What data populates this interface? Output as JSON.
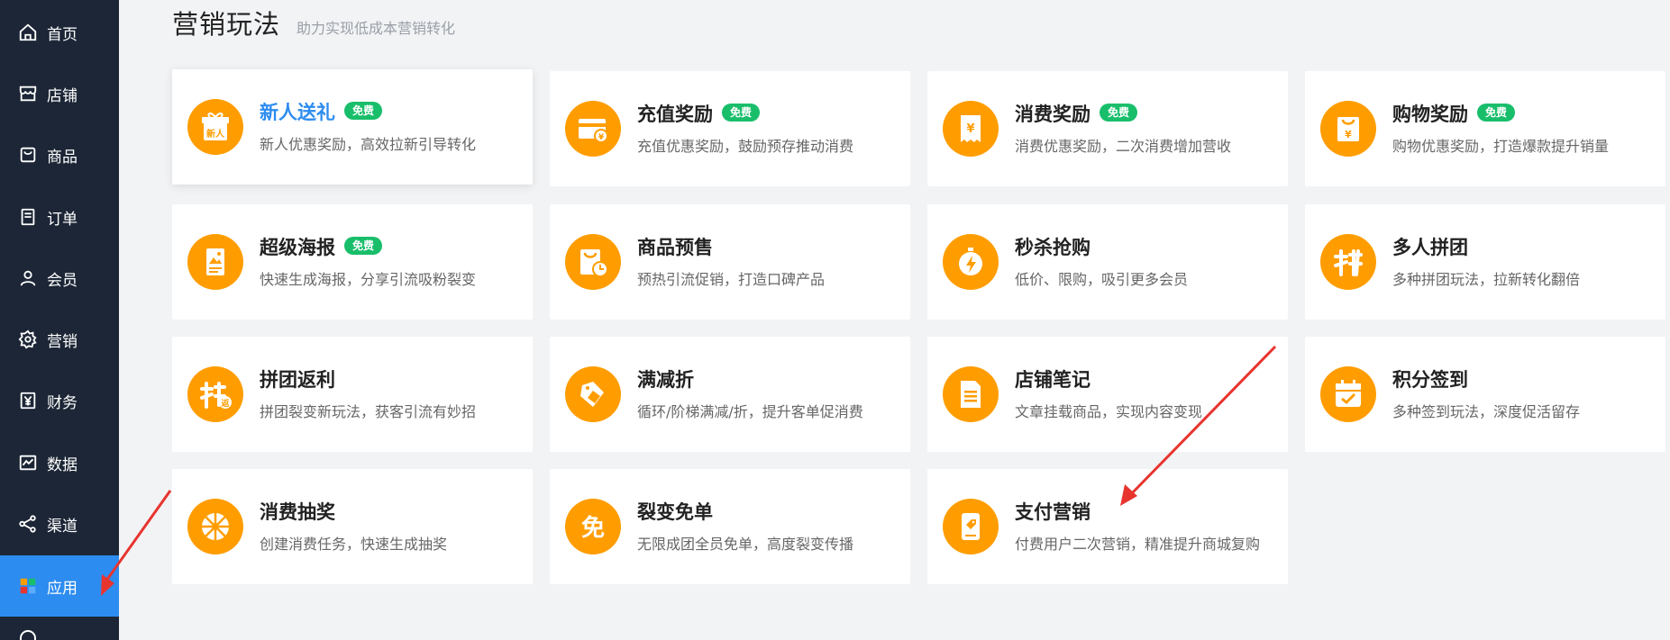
{
  "sidebar": {
    "items": [
      {
        "label": "首页",
        "icon": "home-icon"
      },
      {
        "label": "店铺",
        "icon": "store-icon"
      },
      {
        "label": "商品",
        "icon": "bag-icon"
      },
      {
        "label": "订单",
        "icon": "order-icon"
      },
      {
        "label": "会员",
        "icon": "user-icon"
      },
      {
        "label": "营销",
        "icon": "gear-icon"
      },
      {
        "label": "财务",
        "icon": "yen-icon"
      },
      {
        "label": "数据",
        "icon": "chart-icon"
      },
      {
        "label": "渠道",
        "icon": "share-icon"
      },
      {
        "label": "应用",
        "icon": "apps-icon",
        "active": true
      }
    ]
  },
  "header": {
    "title": "营销玩法",
    "subtitle": "助力实现低成本营销转化"
  },
  "cards": [
    {
      "title": "新人送礼",
      "desc": "新人优惠奖励，高效拉新引导转化",
      "badge": "免费",
      "icon": "gift-new-icon"
    },
    {
      "title": "充值奖励",
      "desc": "充值优惠奖励，鼓励预存推动消费",
      "badge": "免费",
      "icon": "recharge-card-icon"
    },
    {
      "title": "消费奖励",
      "desc": "消费优惠奖励，二次消费增加营收",
      "badge": "免费",
      "icon": "receipt-yen-icon"
    },
    {
      "title": "购物奖励",
      "desc": "购物优惠奖励，打造爆款提升销量",
      "badge": "免费",
      "icon": "shopping-bag-yen-icon"
    },
    {
      "title": "超级海报",
      "desc": "快速生成海报，分享引流吸粉裂变",
      "badge": "免费",
      "icon": "poster-icon"
    },
    {
      "title": "商品预售",
      "desc": "预热引流促销，打造口碑产品",
      "badge": "",
      "icon": "presale-clock-icon"
    },
    {
      "title": "秒杀抢购",
      "desc": "低价、限购，吸引更多会员",
      "badge": "",
      "icon": "flash-sale-icon"
    },
    {
      "title": "多人拼团",
      "desc": "多种拼团玩法，拉新转化翻倍",
      "badge": "",
      "icon": "group-buy-icon"
    },
    {
      "title": "拼团返利",
      "desc": "拼团裂变新玩法，获客引流有妙招",
      "badge": "",
      "icon": "group-rebate-icon"
    },
    {
      "title": "满减折",
      "desc": "循环/阶梯满减/折，提升客单促消费",
      "badge": "",
      "icon": "discount-tag-icon"
    },
    {
      "title": "店铺笔记",
      "desc": "文章挂载商品，实现内容变现",
      "badge": "",
      "icon": "note-icon"
    },
    {
      "title": "积分签到",
      "desc": "多种签到玩法，深度促活留存",
      "badge": "",
      "icon": "calendar-check-icon"
    },
    {
      "title": "消费抽奖",
      "desc": "创建消费任务，快速生成抽奖",
      "badge": "",
      "icon": "lottery-wheel-icon"
    },
    {
      "title": "裂变免单",
      "desc": "无限成团全员免单，高度裂变传播",
      "badge": "",
      "icon": "free-order-icon"
    },
    {
      "title": "支付营销",
      "desc": "付费用户二次营销，精准提升商城复购",
      "badge": "",
      "icon": "pay-marketing-icon"
    }
  ],
  "colors": {
    "sidebar_bg": "#1c2636",
    "active_bg": "#2d8cf0",
    "icon_orange": "#ff9d00",
    "badge_green": "#19be6b",
    "arrow_red": "#e8342f"
  }
}
